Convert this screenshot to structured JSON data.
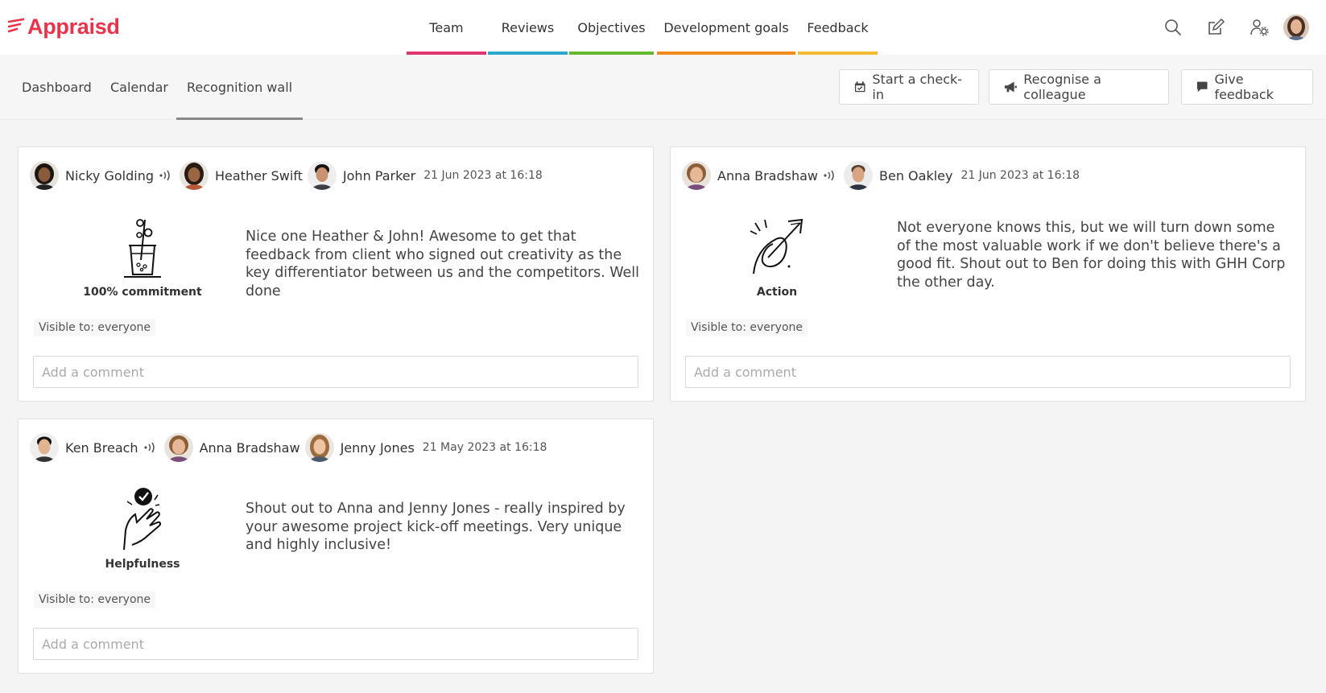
{
  "app": {
    "name": "Appraisd",
    "brand_color": "#e8334a"
  },
  "nav": {
    "items": [
      {
        "label": "Team",
        "color": "#e0356f"
      },
      {
        "label": "Reviews",
        "color": "#2aa7c9"
      },
      {
        "label": "Objectives",
        "color": "#62b92f"
      },
      {
        "label": "Development goals",
        "color": "#ef8a1f"
      },
      {
        "label": "Feedback",
        "color": "#f1bd2f"
      }
    ],
    "icons": [
      "search-icon",
      "edit-icon",
      "user-settings-icon"
    ]
  },
  "subnav": {
    "tabs": [
      {
        "label": "Dashboard"
      },
      {
        "label": "Calendar"
      },
      {
        "label": "Recognition wall",
        "active": true
      }
    ],
    "actions": [
      {
        "label": "Start a check-in",
        "icon": "calendar-check-icon"
      },
      {
        "label": "Recognise a colleague",
        "icon": "megaphone-icon"
      },
      {
        "label": "Give feedback",
        "icon": "speech-bubble-icon"
      }
    ]
  },
  "posts": [
    {
      "from": "Nicky Golding",
      "to": [
        "Heather Swift",
        "John Parker"
      ],
      "date": "21 Jun 2023 at 16:18",
      "badge": "100% commitment",
      "badge_icon": "drink-glass-icon",
      "message": "Nice one Heather & John! Awesome to get that feedback from client who signed out creativity as the key differentiator between us and the competitors. Well done",
      "visible": "Visible to: everyone",
      "comment_placeholder": "Add a comment"
    },
    {
      "from": "Anna Bradshaw",
      "to": [
        "Ben Oakley"
      ],
      "date": "21 Jun 2023 at 16:18",
      "badge": "Action",
      "badge_icon": "rocket-arrow-icon",
      "message": "Not everyone knows this, but we will turn down some of the most valuable work if we don't believe there's a good fit. Shout out to Ben for doing this with GHH Corp the other day.",
      "visible": "Visible to: everyone",
      "comment_placeholder": "Add a comment"
    },
    {
      "from": "Ken Breach",
      "to": [
        "Anna Bradshaw",
        "Jenny Jones"
      ],
      "date": "21 May 2023 at 16:18",
      "badge": "Helpfulness",
      "badge_icon": "helping-hand-icon",
      "message": "Shout out to Anna and Jenny Jones - really inspired by your awesome project kick-off meetings. Very unique and highly inclusive!",
      "visible": "Visible to: everyone",
      "comment_placeholder": "Add a comment"
    }
  ]
}
